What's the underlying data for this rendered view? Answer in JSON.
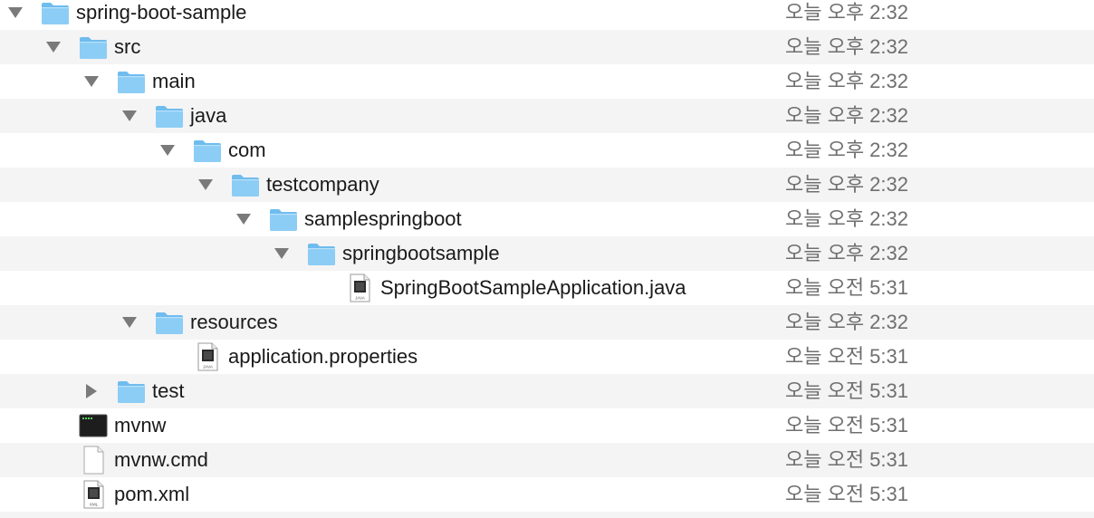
{
  "rows": [
    {
      "name": "spring-boot-sample",
      "modified": "오늘 오후 2:32",
      "icon": "folder-icon",
      "disclosure": "expanded"
    },
    {
      "name": "src",
      "modified": "오늘 오후 2:32",
      "icon": "folder-icon",
      "disclosure": "expanded"
    },
    {
      "name": "main",
      "modified": "오늘 오후 2:32",
      "icon": "folder-icon",
      "disclosure": "expanded"
    },
    {
      "name": "java",
      "modified": "오늘 오후 2:32",
      "icon": "folder-icon",
      "disclosure": "expanded"
    },
    {
      "name": "com",
      "modified": "오늘 오후 2:32",
      "icon": "folder-icon",
      "disclosure": "expanded"
    },
    {
      "name": "testcompany",
      "modified": "오늘 오후 2:32",
      "icon": "folder-icon",
      "disclosure": "expanded"
    },
    {
      "name": "samplespringboot",
      "modified": "오늘 오후 2:32",
      "icon": "folder-icon",
      "disclosure": "expanded"
    },
    {
      "name": "springbootsample",
      "modified": "오늘 오후 2:32",
      "icon": "folder-icon",
      "disclosure": "expanded"
    },
    {
      "name": "SpringBootSampleApplication.java",
      "modified": "오늘 오전 5:31",
      "icon": "java-file-icon",
      "icon_label": "JAVA",
      "disclosure": "none"
    },
    {
      "name": "resources",
      "modified": "오늘 오후 2:32",
      "icon": "folder-icon",
      "disclosure": "expanded"
    },
    {
      "name": "application.properties",
      "modified": "오늘 오전 5:31",
      "icon": "properties-file-icon",
      "icon_label": "JAVA",
      "disclosure": "none"
    },
    {
      "name": "test",
      "modified": "오늘 오전 5:31",
      "icon": "folder-icon",
      "disclosure": "collapsed"
    },
    {
      "name": "mvnw",
      "modified": "오늘 오전 5:31",
      "icon": "terminal-exec-icon",
      "disclosure": "none"
    },
    {
      "name": "mvnw.cmd",
      "modified": "오늘 오전 5:31",
      "icon": "blank-document-icon",
      "disclosure": "none"
    },
    {
      "name": "pom.xml",
      "modified": "오늘 오전 5:31",
      "icon": "xml-file-icon",
      "icon_label": "XML",
      "disclosure": "none"
    }
  ],
  "colors": {
    "folder_body": "#8ccdf5",
    "folder_tab": "#6fbcee",
    "stripe": "#f4f4f4",
    "date_text": "#6f6f6f",
    "disclosure": "#7a7a7a"
  }
}
